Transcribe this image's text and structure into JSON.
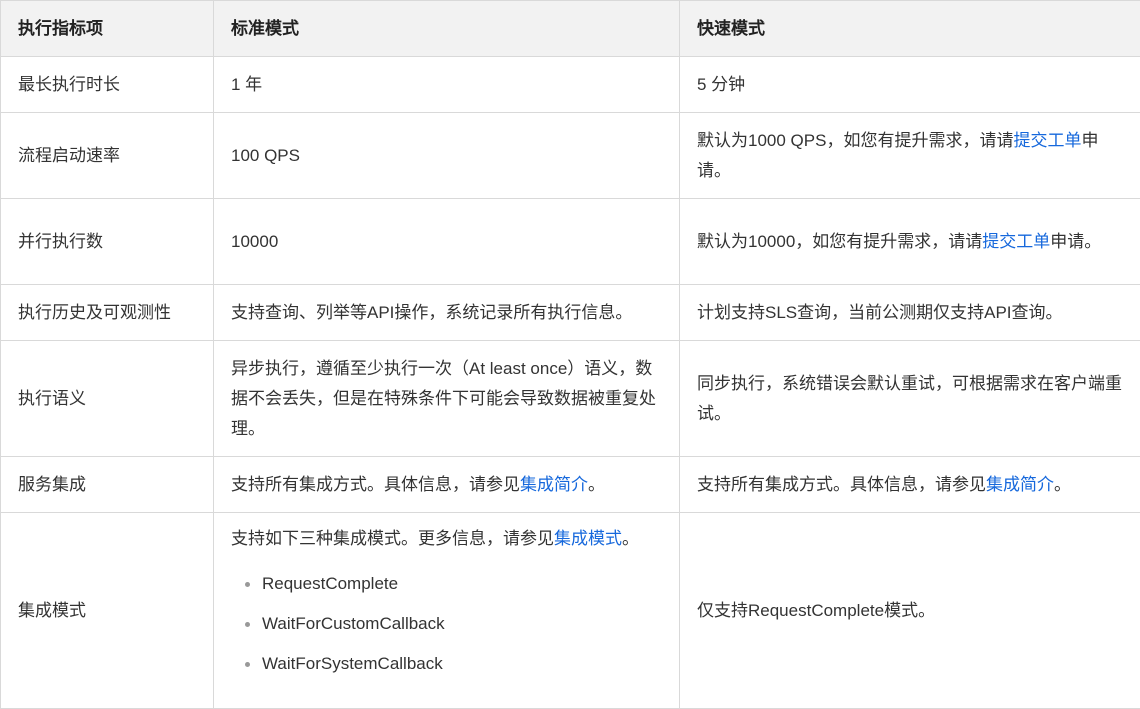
{
  "table": {
    "headers": [
      "执行指标项",
      "标准模式",
      "快速模式"
    ],
    "rows": [
      {
        "metric": "最长执行时长",
        "standard": "1 年",
        "express": "5 分钟"
      },
      {
        "metric": "流程启动速率",
        "standard": "100 QPS",
        "express": {
          "before": "默认为1000 QPS，如您有提升需求，请请",
          "link": "提交工单",
          "after": "申请。"
        }
      },
      {
        "metric": "并行执行数",
        "standard": "10000",
        "express": {
          "before": "默认为10000，如您有提升需求，请请",
          "link": "提交工单",
          "after": "申请。"
        }
      },
      {
        "metric": "执行历史及可观测性",
        "standard": "支持查询、列举等API操作，系统记录所有执行信息。",
        "express": "计划支持SLS查询，当前公测期仅支持API查询。"
      },
      {
        "metric": "执行语义",
        "standard": "异步执行，遵循至少执行一次（At least once）语义，数据不会丢失，但是在特殊条件下可能会导致数据被重复处理。",
        "express": "同步执行，系统错误会默认重试，可根据需求在客户端重试。"
      },
      {
        "metric": "服务集成",
        "standard": {
          "before": "支持所有集成方式。具体信息，请参见",
          "link": "集成简介",
          "after": "。"
        },
        "express": {
          "before": "支持所有集成方式。具体信息，请参见",
          "link": "集成简介",
          "after": "。"
        }
      },
      {
        "metric": "集成模式",
        "standard": {
          "before": "支持如下三种集成模式。更多信息，请参见",
          "link": "集成模式",
          "after": "。",
          "items": [
            "RequestComplete",
            "WaitForCustomCallback",
            "WaitForSystemCallback"
          ]
        },
        "express": "仅支持RequestComplete模式。"
      }
    ]
  },
  "colors": {
    "link": "#1668dc",
    "header_bg": "#f2f2f2",
    "border": "#d9d9d9",
    "text": "#333333"
  }
}
